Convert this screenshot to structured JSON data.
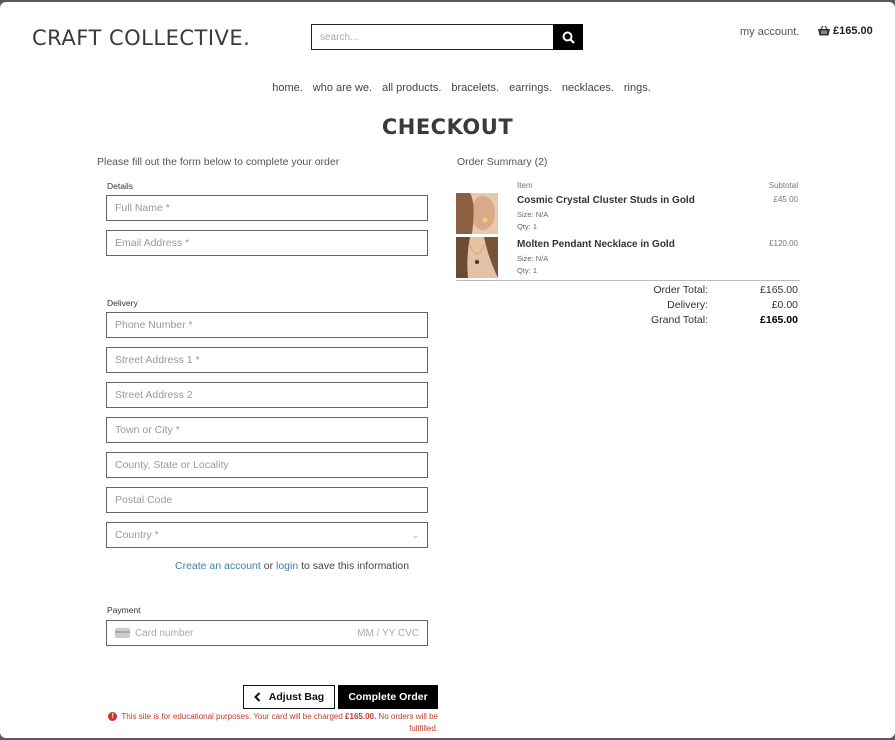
{
  "header": {
    "logo": "CRAFT COLLECTIVE.",
    "search_placeholder": "search...",
    "account_link": "my account.",
    "bag_total": "£165.00"
  },
  "nav": [
    "home.",
    "who are we.",
    "all products.",
    "bracelets.",
    "earrings.",
    "necklaces.",
    "rings."
  ],
  "page_title": "CHECKOUT",
  "form": {
    "intro": "Please fill out the form below to complete your order",
    "details_label": "Details",
    "full_name_placeholder": "Full Name *",
    "email_placeholder": "Email Address *",
    "delivery_label": "Delivery",
    "phone_placeholder": "Phone Number *",
    "street1_placeholder": "Street Address 1 *",
    "street2_placeholder": "Street Address 2",
    "town_placeholder": "Town or City *",
    "county_placeholder": "County, State or Locality",
    "postcode_placeholder": "Postal Code",
    "country_selected": "Country *",
    "create_account_link": "Create an account",
    "or_text": "or",
    "login_link": "login",
    "save_text": "to save this information",
    "payment_label": "Payment",
    "card_number_placeholder": "Card number",
    "card_expiry_cvc": "MM / YY  CVC",
    "adjust_bag_label": "Adjust Bag",
    "complete_order_label": "Complete Order",
    "notice_prefix": "This site is for educational purposes. Your card will be charged",
    "notice_amount": "£165.00.",
    "notice_suffix": "No orders will be fullfilled."
  },
  "summary": {
    "title": "Order Summary (2)",
    "col_item": "Item",
    "col_subtotal": "Subtotal",
    "items": [
      {
        "name": "Cosmic Crystal Cluster Studs in Gold",
        "size": "Size: N/A",
        "qty": "Qty: 1",
        "price": "£45.00"
      },
      {
        "name": "Molten Pendant Necklace in Gold",
        "size": "Size: N/A",
        "qty": "Qty: 1",
        "price": "£120.00"
      }
    ],
    "order_total_label": "Order Total:",
    "order_total": "£165.00",
    "delivery_label": "Delivery:",
    "delivery": "£0.00",
    "grand_total_label": "Grand Total:",
    "grand_total": "£165.00"
  },
  "colors": {
    "link": "#3b82a8",
    "notice": "#c0392b",
    "button_dark": "#000000"
  }
}
